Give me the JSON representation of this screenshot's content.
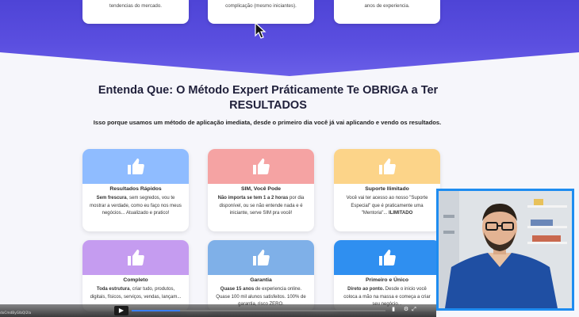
{
  "top_cards": [
    {
      "text": "tendencias do mercado."
    },
    {
      "text": "complicação (mesmo iniciantes)."
    },
    {
      "text": "anos de experiencia."
    }
  ],
  "headline": "Entenda Que: O Método Expert Práticamente Te OBRIGA a Ter RESULTADOS",
  "subhead": "Isso porque usamos um método de aplicação imediata, desde o primeiro dia você já vai aplicando e vendo os resultados.",
  "cards": [
    {
      "title": "Resultados Rápidos",
      "color": "#8fbcff",
      "strong": "Sem frescura",
      "text": ", sem segredos, vou te mostrar a verdade, como eu faço nos meus negócios... Atualizado e pratico!"
    },
    {
      "title": "SIM, Você Pode",
      "color": "#f5a3a3",
      "strong": "Não importa se tem 1 a 2 horas",
      "text": " por dia disponível, ou se não entende nada e é iniciante, serve SIM pra você!"
    },
    {
      "title": "Suporte Ilimitado",
      "color": "#fcd489",
      "strong": "ILIMITADO",
      "text": "Você vai ter acesso ao nosso \"Suporte Especial\" que é praticamente uma \"Mentoria\"... "
    },
    {
      "title": "Completo",
      "color": "#c59cf0",
      "strong": "Toda estrutura",
      "text": ", criar tudo, produtos, digitais, físicos, serviços, vendas, lançam..."
    },
    {
      "title": "Garantia",
      "color": "#7fb0e8",
      "strong": "Quase 15 anos",
      "text": " de experiencia online. Quase 100 mil alunos satisfeitos. 100% de garantia, risco ZERO."
    },
    {
      "title": "Primeiro e Único",
      "color": "#2f8ff0",
      "strong": "Direto ao ponto.",
      "text": " Desde o inicio você coloca a mão na massa e começa a criar seu negócio..."
    }
  ],
  "player": {
    "time": "08:59",
    "progress": 0.19,
    "corner_label": "doCmdByGlbQl2la"
  }
}
